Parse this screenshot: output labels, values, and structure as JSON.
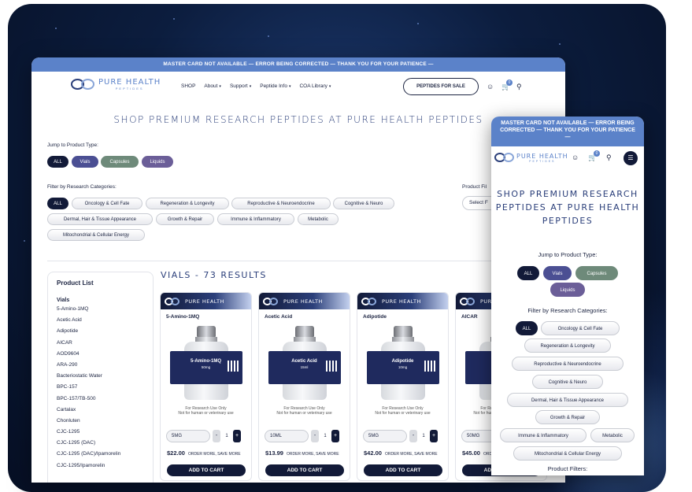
{
  "banner": "MASTER CARD NOT AVAILABLE — ERROR BEING CORRECTED — THANK YOU FOR YOUR PATIENCE —",
  "logo": {
    "name": "PURE HEALTH",
    "sub": "PEPTIDES"
  },
  "nav": {
    "items": [
      "SHOP",
      "About",
      "Support",
      "Peptide Info",
      "COA Library"
    ],
    "cta": "PEPTIDES FOR SALE",
    "cart_count": "0"
  },
  "heading": "SHOP PREMIUM RESEARCH PEPTIDES AT PURE HEALTH PEPTIDES",
  "jump": {
    "label": "Jump to Product Type:",
    "types": [
      "ALL",
      "Vials",
      "Capsules",
      "Liquids"
    ]
  },
  "filter": {
    "label": "Filter by Research Categories:",
    "categories": [
      "ALL",
      "Oncology & Cell Fate",
      "Regeneration & Longevity",
      "Reproductive & Neuroendocrine",
      "Cognitive & Neuro",
      "Dermal, Hair & Tissue Appearance",
      "Growth & Repair",
      "Immune & Inflammatory",
      "Metabolic",
      "Mitochondrial & Cellular Energy"
    ]
  },
  "product_filter": {
    "label": "Product Fil",
    "select": "Select F"
  },
  "product_list": {
    "title": "Product List",
    "group": "Vials",
    "items": [
      "5-Amino-1MQ",
      "Acetic Acid",
      "Adipotide",
      "AICAR",
      "AOD9604",
      "ARA-290",
      "Bacteriostatic Water",
      "BPC-157",
      "BPC-157/TB-500",
      "Cartalax",
      "Chonluten",
      "CJC-1295",
      "CJC-1295 (DAC)",
      "CJC-1295 (DAC)/Ipamorelin",
      "CJC-1295/Ipamorelin"
    ]
  },
  "results": "VIALS - 73 RESULTS",
  "products": [
    {
      "name": "5-Amino-1MQ",
      "label_name": "5-Amino-1MQ",
      "label_dose": "50mg",
      "size": "5MG",
      "qty": "1",
      "price": "$22.00"
    },
    {
      "name": "Acetic Acid",
      "label_name": "Acetic Acid",
      "label_dose": "15ml",
      "size": "10ML",
      "qty": "1",
      "price": "$13.99"
    },
    {
      "name": "Adipotide",
      "label_name": "Adipotide",
      "label_dose": "10mg",
      "size": "5MG",
      "qty": "1",
      "price": "$42.00"
    },
    {
      "name": "AICAR",
      "label_name": "",
      "label_dose": "",
      "size": "50MG",
      "qty": "1",
      "price": "$45.00"
    }
  ],
  "card_common": {
    "order_note": "ORDER MORE, SAVE MORE",
    "atc": "ADD TO CART",
    "research": "For Research Use Only",
    "notfor": "Not for human or veterinary use",
    "minus": "-",
    "plus": "+"
  },
  "mobile": {
    "banner": "MASTER CARD NOT AVAILABLE — ERROR BEING CORRECTED — THANK YOU FOR YOUR PATIENCE —",
    "heading": "SHOP PREMIUM RESEARCH PEPTIDES AT PURE HEALTH PEPTIDES",
    "product_filters": "Product Filters:",
    "cart_count": "0"
  },
  "colors": {
    "banner": "#5b82c9",
    "navy": "#121a38",
    "accent": "#2b3f7a"
  }
}
